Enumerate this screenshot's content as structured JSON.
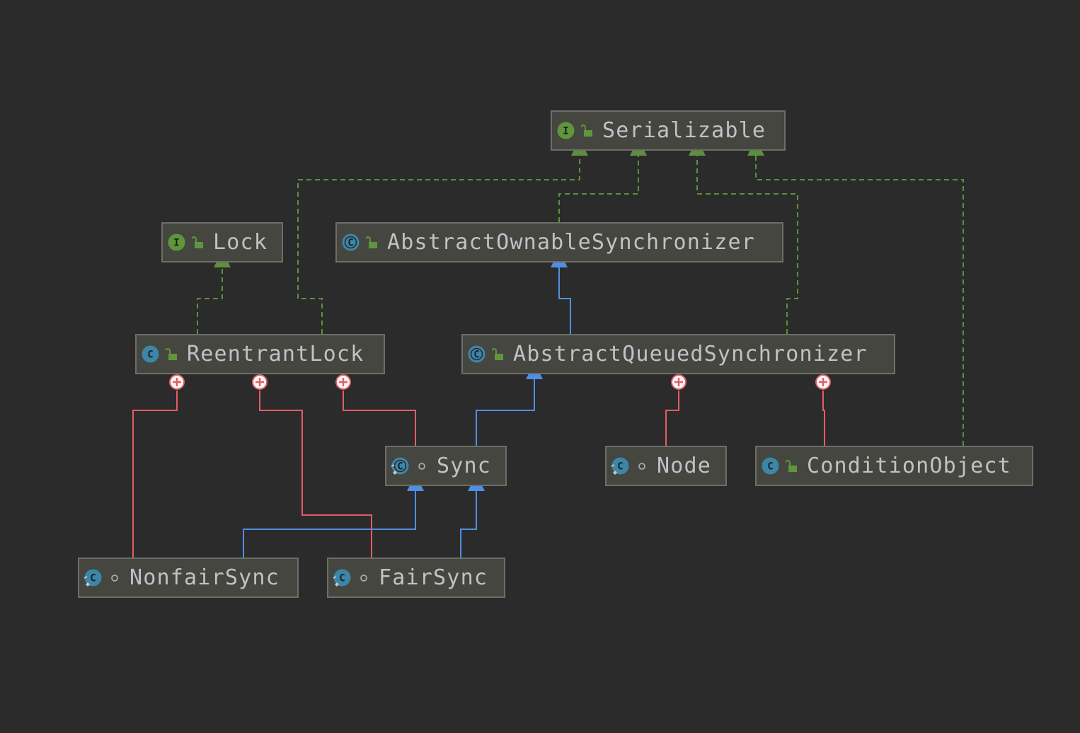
{
  "colors": {
    "background": "#2b2b2b",
    "box_fill": "#45463f",
    "box_border": "#6d6e66",
    "label_text": "#bfc2c6",
    "implements_edge": "#5e8f3e",
    "extends_edge": "#4f8fe3",
    "inner_class_edge": "#e35d63",
    "interface_badge": "#5f963c",
    "class_badge": "#3c86a8"
  },
  "nodes": [
    {
      "id": "serializable",
      "label": "Serializable",
      "kind": "interface",
      "access": "public-icon"
    },
    {
      "id": "lock",
      "label": "Lock",
      "kind": "interface",
      "access": "public-icon"
    },
    {
      "id": "aos",
      "label": "AbstractOwnableSynchronizer",
      "kind": "abstract-class",
      "access": "public-icon"
    },
    {
      "id": "reentrantlock",
      "label": "ReentrantLock",
      "kind": "class",
      "access": "public-icon"
    },
    {
      "id": "aqs",
      "label": "AbstractQueuedSynchronizer",
      "kind": "abstract-class",
      "access": "public-icon"
    },
    {
      "id": "sync",
      "label": "Sync",
      "kind": "abstract-static-class",
      "access": "package-private-icon"
    },
    {
      "id": "node",
      "label": "Node",
      "kind": "static-class",
      "access": "package-private-icon"
    },
    {
      "id": "conditionobject",
      "label": "ConditionObject",
      "kind": "class",
      "access": "public-icon"
    },
    {
      "id": "nonfairsync",
      "label": "NonfairSync",
      "kind": "static-class",
      "access": "package-private-icon"
    },
    {
      "id": "fairsync",
      "label": "FairSync",
      "kind": "static-class",
      "access": "package-private-icon"
    }
  ],
  "edges": [
    {
      "from": "reentrantlock",
      "to": "serializable",
      "type": "implements"
    },
    {
      "from": "aos",
      "to": "serializable",
      "type": "implements"
    },
    {
      "from": "aqs",
      "to": "serializable",
      "type": "implements"
    },
    {
      "from": "conditionobject",
      "to": "serializable",
      "type": "implements"
    },
    {
      "from": "reentrantlock",
      "to": "lock",
      "type": "implements"
    },
    {
      "from": "aqs",
      "to": "aos",
      "type": "extends"
    },
    {
      "from": "sync",
      "to": "aqs",
      "type": "extends"
    },
    {
      "from": "nonfairsync",
      "to": "sync",
      "type": "extends"
    },
    {
      "from": "fairsync",
      "to": "sync",
      "type": "extends"
    },
    {
      "from": "nonfairsync",
      "to": "reentrantlock",
      "type": "inner-class"
    },
    {
      "from": "fairsync",
      "to": "reentrantlock",
      "type": "inner-class"
    },
    {
      "from": "sync",
      "to": "reentrantlock",
      "type": "inner-class"
    },
    {
      "from": "node",
      "to": "aqs",
      "type": "inner-class"
    },
    {
      "from": "conditionobject",
      "to": "aqs",
      "type": "inner-class"
    }
  ]
}
